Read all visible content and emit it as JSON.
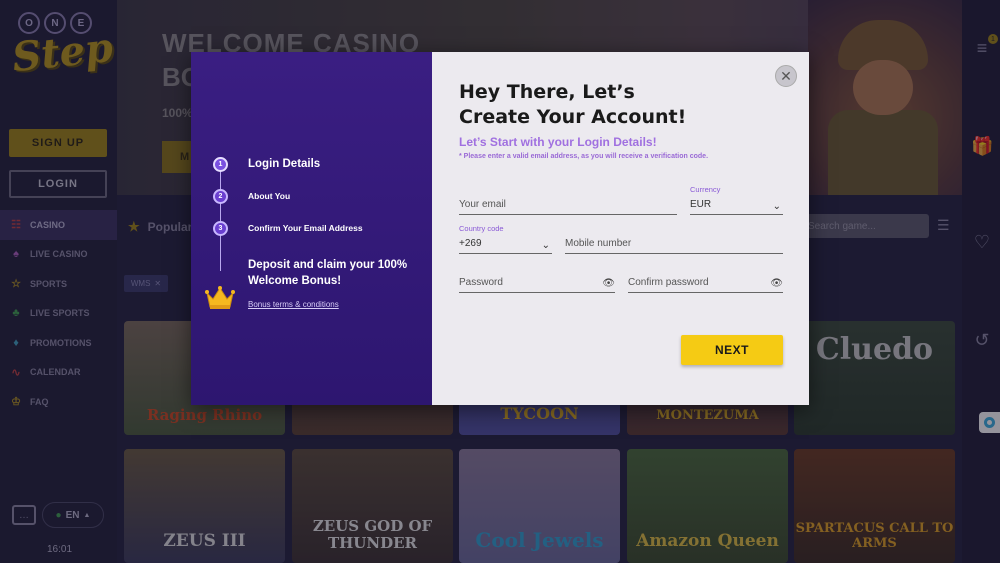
{
  "sidebar": {
    "logo_one": [
      "O",
      "N",
      "E"
    ],
    "logo_step": "Step",
    "signup_label": "SIGN UP",
    "login_label": "LOGIN",
    "nav": [
      {
        "label": "CASINO",
        "icon": "slot-icon",
        "active": true
      },
      {
        "label": "LIVE CASINO",
        "icon": "spade-icon",
        "active": false
      },
      {
        "label": "SPORTS",
        "icon": "star-icon",
        "active": false
      },
      {
        "label": "LIVE SPORTS",
        "icon": "clover-icon",
        "active": false
      },
      {
        "label": "PROMOTIONS",
        "icon": "diamond-icon",
        "active": false
      },
      {
        "label": "CALENDAR",
        "icon": "swirl-icon",
        "active": false
      },
      {
        "label": "FAQ",
        "icon": "crown-icon",
        "active": false
      }
    ],
    "language": "EN",
    "time": "16:01"
  },
  "hero": {
    "title_line1": "WELCOME CASINO",
    "title_line2": "BO",
    "subtitle": "100%",
    "cta_partial": "M"
  },
  "toolbar": {
    "popular_label": "Popular",
    "search_placeholder": "Search game...",
    "filter_chip": "WMS"
  },
  "games": [
    {
      "title": "Raging Rhino"
    },
    {
      "title": ""
    },
    {
      "title": "TYCOON"
    },
    {
      "title": "MONTEZUMA"
    },
    {
      "title": "Cluedo"
    },
    {
      "title": "ZEUS III"
    },
    {
      "title": "ZEUS GOD OF THUNDER"
    },
    {
      "title": "Cool Jewels"
    },
    {
      "title": "Amazon Queen"
    },
    {
      "title": "SPARTACUS CALL TO ARMS"
    }
  ],
  "modal": {
    "steps": [
      {
        "num": "1",
        "label": "Login Details"
      },
      {
        "num": "2",
        "label": "About You"
      },
      {
        "num": "3",
        "label": "Confirm Your Email Address"
      }
    ],
    "promo_text": "Deposit and claim your 100% Welcome Bonus!",
    "terms_link": "Bonus terms & conditions",
    "title_line1": "Hey There, Let’s",
    "title_line2": "Create Your Account!",
    "subtitle": "Let’s Start with your Login Details!",
    "note": "* Please enter a valid email address, as you will receive a verification code.",
    "email_placeholder": "Your email",
    "currency_label": "Currency",
    "currency_value": "EUR",
    "country_code_label": "Country code",
    "country_code_value": "+269",
    "mobile_placeholder": "Mobile number",
    "password_placeholder": "Password",
    "confirm_password_placeholder": "Confirm password",
    "next_label": "NEXT"
  },
  "rail": {
    "notification_count": "1"
  }
}
